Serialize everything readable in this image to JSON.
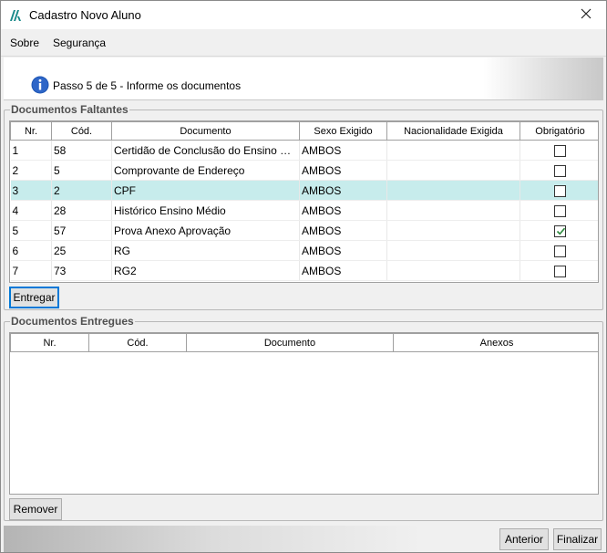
{
  "window": {
    "title": "Cadastro Novo Aluno",
    "close_glyph": "✕"
  },
  "menu": {
    "items": [
      {
        "label": "Sobre"
      },
      {
        "label": "Segurança"
      }
    ]
  },
  "header": {
    "step_text": "Passo 5 de 5 - Informe os documentos",
    "icon": "info-icon"
  },
  "faltantes": {
    "legend": "Documentos Faltantes",
    "columns": [
      "Nr.",
      "Cód.",
      "Documento",
      "Sexo Exigido",
      "Nacionalidade Exigida",
      "Obrigatório"
    ],
    "rows": [
      {
        "nr": "1",
        "cod": "58",
        "documento": "Certidão de Conclusão do Ensino Médio",
        "sexo": "AMBOS",
        "nacionalidade": "",
        "obrigatorio": false
      },
      {
        "nr": "2",
        "cod": "5",
        "documento": "Comprovante de Endereço",
        "sexo": "AMBOS",
        "nacionalidade": "",
        "obrigatorio": false
      },
      {
        "nr": "3",
        "cod": "2",
        "documento": "CPF",
        "sexo": "AMBOS",
        "nacionalidade": "",
        "obrigatorio": false,
        "selected": true
      },
      {
        "nr": "4",
        "cod": "28",
        "documento": "Histórico Ensino Médio",
        "sexo": "AMBOS",
        "nacionalidade": "",
        "obrigatorio": false
      },
      {
        "nr": "5",
        "cod": "57",
        "documento": "Prova Anexo Aprovação",
        "sexo": "AMBOS",
        "nacionalidade": "",
        "obrigatorio": true
      },
      {
        "nr": "6",
        "cod": "25",
        "documento": "RG",
        "sexo": "AMBOS",
        "nacionalidade": "",
        "obrigatorio": false
      },
      {
        "nr": "7",
        "cod": "73",
        "documento": "RG2",
        "sexo": "AMBOS",
        "nacionalidade": "",
        "obrigatorio": false
      }
    ],
    "button_label": "Entregar"
  },
  "entregues": {
    "legend": "Documentos Entregues",
    "columns": [
      "Nr.",
      "Cód.",
      "Documento",
      "Anexos"
    ],
    "rows": [],
    "button_label": "Remover"
  },
  "footer": {
    "anterior_label": "Anterior",
    "finalizar_label": "Finalizar"
  },
  "colors": {
    "selected_row": "#c7ecec",
    "info_blue": "#1e56b4",
    "check_green": "#2d8a3e"
  }
}
